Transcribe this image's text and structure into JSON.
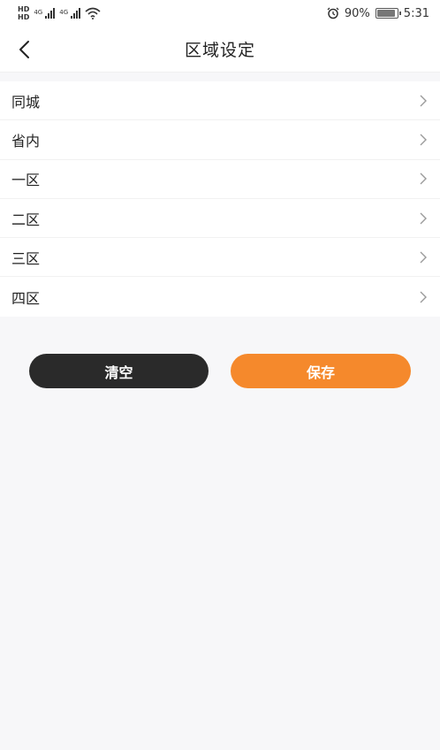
{
  "status_bar": {
    "hd_top": "HD",
    "hd_bottom": "HD",
    "net1": "4G",
    "net2": "4G",
    "battery_percent": "90%",
    "battery_level": 0.9,
    "time": "5:31",
    "icons": [
      "signal-icon",
      "wifi-icon",
      "alarm-icon",
      "battery-icon"
    ]
  },
  "header": {
    "title": "区域设定",
    "back_icon": "chevron-left-icon"
  },
  "regions": [
    {
      "label": "同城"
    },
    {
      "label": "省内"
    },
    {
      "label": "一区"
    },
    {
      "label": "二区"
    },
    {
      "label": "三区"
    },
    {
      "label": "四区"
    }
  ],
  "actions": {
    "clear_label": "清空",
    "save_label": "保存"
  },
  "colors": {
    "accent": "#f5892c",
    "dark": "#2a2a2a",
    "background": "#f7f7f9"
  }
}
